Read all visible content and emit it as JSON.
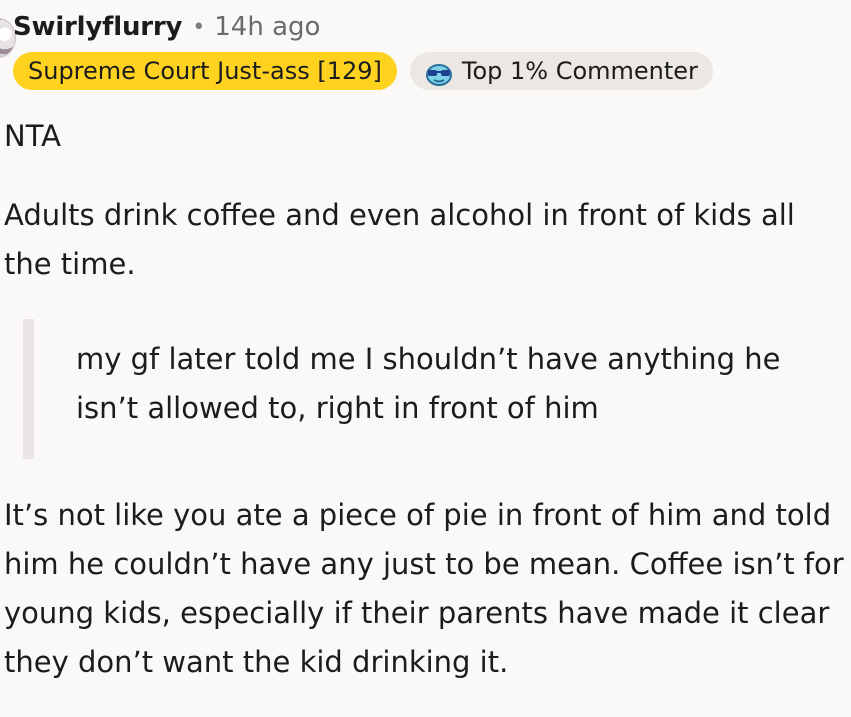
{
  "comment": {
    "author": "Swirlyflurry",
    "separator": "•",
    "timestamp": "14h ago",
    "flair": "Supreme Court Just-ass [129]",
    "achievement": {
      "icon": "sunglasses-face-icon",
      "label": "Top 1% Commenter"
    },
    "paragraphs": {
      "p1": "NTA",
      "p2": "Adults drink coffee and even alcohol in front of kids all the time.",
      "quote": "my gf later told me I shouldn’t have anything he isn’t allowed to, right in front of him",
      "p3": "It’s not like you ate a piece of pie in front of him and told him he couldn’t have any just to be mean. Coffee isn’t for young kids, especially if their parents have made it clear they don’t want the kid drinking it."
    }
  },
  "colors": {
    "background": "#faf9f7",
    "flair_bg": "#ffd21f",
    "achievement_bg": "#ebe7e2",
    "quote_bar": "#ebe5e5",
    "meta_text": "#6b6b6b"
  }
}
